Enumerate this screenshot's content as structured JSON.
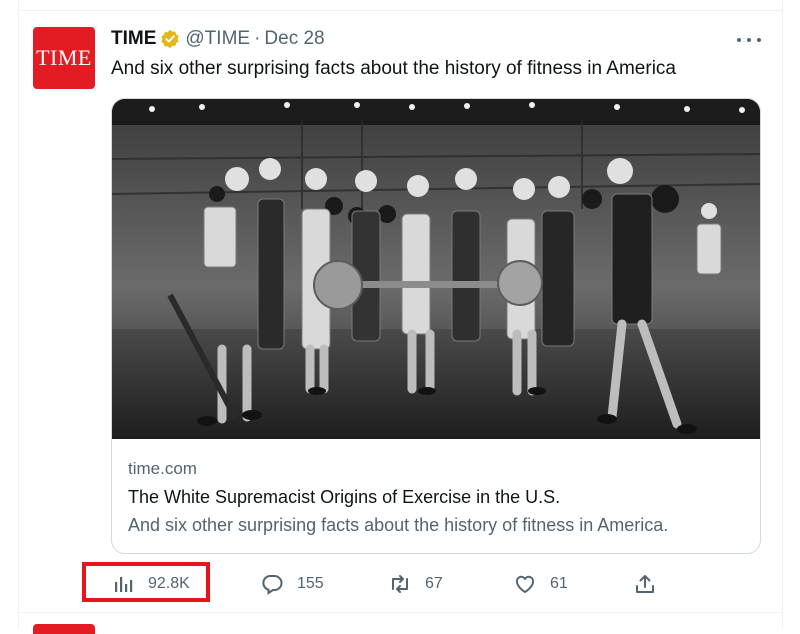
{
  "tweet": {
    "avatar_text": "TIME",
    "display_name": "TIME",
    "handle": "@TIME",
    "separator": "·",
    "date": "Dec 28",
    "text": "And six other surprising facts about the history of fitness in America"
  },
  "card": {
    "domain": "time.com",
    "title": "The White Supremacist Origins of Exercise in the U.S.",
    "description": "And six other surprising facts about the history of fitness in America."
  },
  "actions": {
    "views": "92.8K",
    "replies": "155",
    "retweets": "67",
    "likes": "61"
  },
  "icons": [
    "verified-badge-icon",
    "more-icon",
    "views-icon",
    "reply-icon",
    "retweet-icon",
    "like-icon",
    "share-icon"
  ],
  "colors": {
    "brand_red": "#e31c23",
    "verified_gold": "#e2b719",
    "secondary_text": "#536471",
    "highlight_box": "#e8141d"
  }
}
